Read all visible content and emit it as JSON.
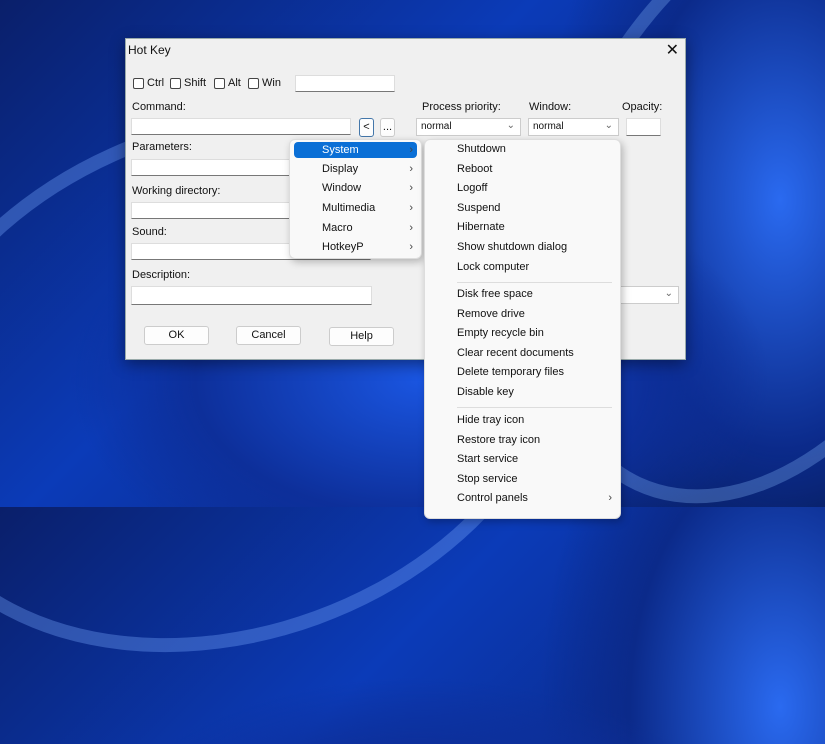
{
  "dialog": {
    "title": "Hot Key",
    "modifiers": [
      "Ctrl",
      "Shift",
      "Alt",
      "Win"
    ],
    "labels": {
      "command": "Command:",
      "parameters": "Parameters:",
      "working_directory": "Working directory:",
      "sound": "Sound:",
      "description": "Description:",
      "process_priority": "Process priority:",
      "window": "Window:",
      "opacity": "Opacity:"
    },
    "process_priority_value": "normal",
    "window_value": "normal",
    "browse_back": "<",
    "browse_more": "...",
    "buttons": {
      "ok": "OK",
      "cancel": "Cancel",
      "help": "Help"
    }
  },
  "menu": {
    "items": [
      "System",
      "Display",
      "Window",
      "Multimedia",
      "Macro",
      "HotkeyP"
    ]
  },
  "submenu": {
    "group1": [
      "Shutdown",
      "Reboot",
      "Logoff",
      "Suspend",
      "Hibernate",
      "Show shutdown dialog",
      "Lock computer"
    ],
    "group2": [
      "Disk free space",
      "Remove drive",
      "Empty recycle bin",
      "Clear recent documents",
      "Delete temporary files",
      "Disable key"
    ],
    "group3": [
      "Hide tray icon",
      "Restore tray icon",
      "Start service",
      "Stop service",
      "Control panels"
    ]
  }
}
